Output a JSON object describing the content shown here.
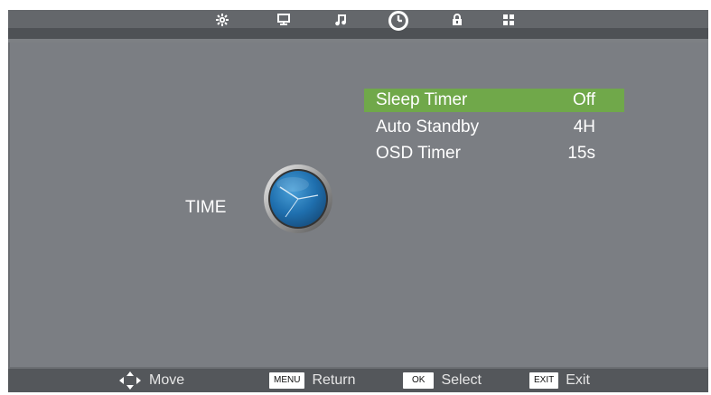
{
  "tabs": [
    {
      "icon": "picture-icon"
    },
    {
      "icon": "monitor-icon"
    },
    {
      "icon": "music-icon"
    },
    {
      "icon": "clock-icon",
      "active": true
    },
    {
      "icon": "lock-icon"
    },
    {
      "icon": "grid-icon"
    }
  ],
  "page": {
    "title": "TIME"
  },
  "menu": [
    {
      "label": "Sleep Timer",
      "value": "Off",
      "selected": true
    },
    {
      "label": "Auto Standby",
      "value": "4H",
      "selected": false
    },
    {
      "label": "OSD Timer",
      "value": "15s",
      "selected": false
    }
  ],
  "help": {
    "move": {
      "label": "Move"
    },
    "return": {
      "key": "MENU",
      "label": "Return"
    },
    "select": {
      "key": "OK",
      "label": "Select"
    },
    "exit": {
      "key": "EXIT",
      "label": "Exit"
    }
  },
  "colors": {
    "background": "#7b7e83",
    "highlight": "#70a84a",
    "topbar": "#5a5d61"
  }
}
